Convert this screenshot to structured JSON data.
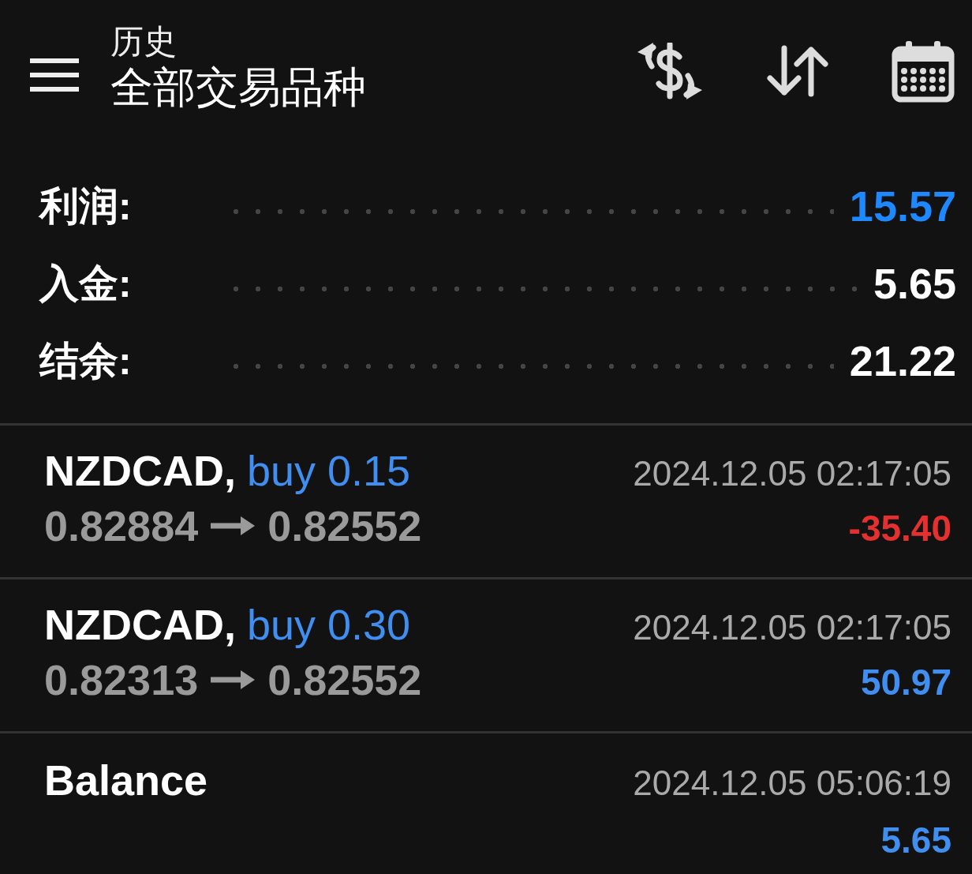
{
  "header": {
    "title": "历史",
    "subtitle": "全部交易品种"
  },
  "summary": [
    {
      "label": "利润:",
      "value": "15.57",
      "highlight": true
    },
    {
      "label": "入金:",
      "value": "5.65",
      "highlight": false
    },
    {
      "label": "结余:",
      "value": "21.22",
      "highlight": false
    }
  ],
  "deals": [
    {
      "kind": "trade",
      "symbol": "NZDCAD,",
      "action": "buy 0.15",
      "time": "2024.12.05 02:17:05",
      "open_price": "0.82884",
      "close_price": "0.82552",
      "profit": "-35.40",
      "color": "#e53030"
    },
    {
      "kind": "trade",
      "symbol": "NZDCAD,",
      "action": "buy 0.30",
      "time": "2024.12.05 02:17:05",
      "open_price": "0.82313",
      "close_price": "0.82552",
      "profit": "50.97",
      "color": "#3f8ef0"
    },
    {
      "kind": "balance",
      "symbol": "Balance",
      "time": "2024.12.05 05:06:19",
      "profit": "5.65",
      "color": "#3f8ef0"
    }
  ]
}
